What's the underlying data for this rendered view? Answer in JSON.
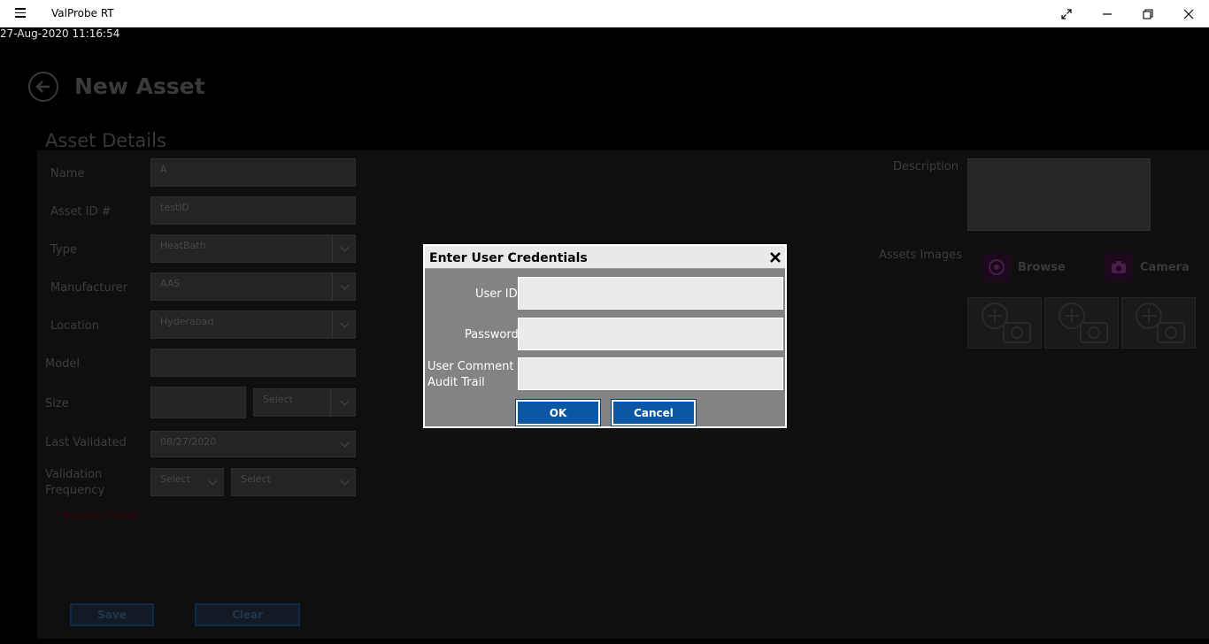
{
  "window": {
    "title": "ValProbe RT",
    "controls": {
      "fullscreen_icon": "expand-icon",
      "minimize_icon": "minimize-icon",
      "restore_icon": "restore-icon",
      "close_icon": "close-icon"
    }
  },
  "timestamp": "27-Aug-2020 11:16:54",
  "page": {
    "title": "New Asset",
    "section_title": "Asset Details",
    "fields": {
      "name": {
        "label": "Name",
        "value": "A"
      },
      "asset_id": {
        "label": "Asset ID #",
        "value": "testID"
      },
      "type": {
        "label": "Type",
        "value": "HeatBath"
      },
      "manufacturer": {
        "label": "Manufacturer",
        "value": "AAS"
      },
      "location": {
        "label": "Location",
        "value": "Hyderabad"
      },
      "model": {
        "label": "Model",
        "value": ""
      },
      "size": {
        "label": "Size",
        "value": "",
        "unit_value": "Select"
      },
      "last_validated": {
        "label": "Last Validated",
        "value": "08/27/2020"
      },
      "validation_frequency": {
        "label_line1": "Validation",
        "label_line2": "Frequency",
        "value1": "Select",
        "value2": "Select"
      },
      "description": {
        "label": "Description",
        "value": ""
      }
    },
    "required_note": "* Required Fields",
    "assets_images": {
      "label": "Assets Images",
      "browse_label": "Browse",
      "camera_label": "Camera"
    },
    "buttons": {
      "save": "Save",
      "clear": "Clear"
    }
  },
  "dialog": {
    "title": "Enter User Credentials",
    "user_id_label": "User ID",
    "user_id_value": "",
    "password_label": "Password",
    "password_value": "",
    "comment_label_line1": "User Comment -",
    "comment_label_line2": "Audit Trail",
    "comment_value": "",
    "ok_label": "OK",
    "cancel_label": "Cancel"
  },
  "colors": {
    "dialog_button": "#0b57a4",
    "dialog_body": "#838383",
    "title_bar": "#ffffff"
  }
}
